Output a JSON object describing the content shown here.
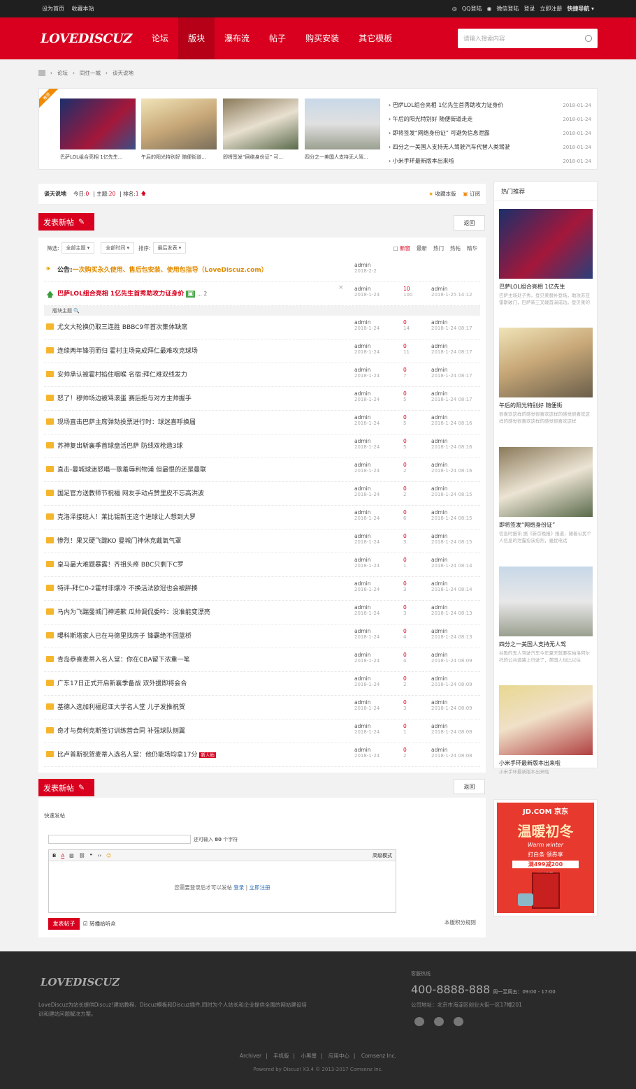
{
  "topbar": {
    "set_home": "设为首页",
    "bookmark": "收藏本站",
    "qq_login": "QQ登陆",
    "wechat_login": "微信登陆",
    "login": "登录",
    "register": "立即注册",
    "quick_nav": "快捷导航"
  },
  "header": {
    "logo": "LOVEDISCUZ",
    "nav": [
      "论坛",
      "版块",
      "瀑布流",
      "帖子",
      "购买安装",
      "其它模板"
    ],
    "search_placeholder": "请输入搜索内容"
  },
  "breadcrumb": [
    "论坛",
    "同住一城",
    "谈天说地"
  ],
  "recommend": {
    "ribbon": "推荐",
    "thumbs": [
      "巴萨LOL组合亮相 1亿先生...",
      "午后的阳光特别好 随便街道...",
      "即将签发“网络身份证” 可...",
      "四分之一美国人支持无人驾..."
    ],
    "list": [
      {
        "title": "巴萨LOL组合亮相 1亿先生首秀助攻力证身价",
        "date": "2018-01-24"
      },
      {
        "title": "午后的阳光特别好 随便街道走走",
        "date": "2018-01-24"
      },
      {
        "title": "即将签发“网络身份证” 可避免信息泄露",
        "date": "2018-01-24"
      },
      {
        "title": "四分之一美国人支持无人驾驶汽车代替人类驾驶",
        "date": "2018-01-24"
      },
      {
        "title": "小米手环最新版本出来啦",
        "date": "2018-01-24"
      }
    ]
  },
  "forum": {
    "name": "谈天说地",
    "today_label": "今日:",
    "today": "0",
    "topics_label": "主题:",
    "topics": "20",
    "rank_label": "排名:",
    "rank": "1",
    "fav": "收藏本版",
    "subscribe": "订阅"
  },
  "actions": {
    "new_post": "发表新帖",
    "back": "返回"
  },
  "filter": {
    "label": "筛选:",
    "type": "全部主题",
    "time": "全部时间",
    "sort_label": "排序:",
    "sort": "最后发表",
    "new_window": "新窗",
    "latest": "最新",
    "hot": "热门",
    "hot_posts": "热帖",
    "digest": "精华"
  },
  "announce": {
    "label": "公告:",
    "text": "一次购买永久使用、售后包安装、使用包指导（LoveDiscuz.com）",
    "author": "admin",
    "date": "2018-2-2"
  },
  "sticky": {
    "title": "巴萨LOL组合亮相 1亿先生首秀助攻力证身价",
    "pages": "... 2",
    "author": "admin",
    "date": "2018-1-24",
    "replies": "10",
    "views": "100",
    "last_user": "admin",
    "last_time": "2018-1-25 14:12"
  },
  "subhead": "版块主题",
  "threads": [
    {
      "title": "尤文大轮换仍取三连胜 BBBC9年首次集体缺席",
      "date": "2018-1-24",
      "replies": "0",
      "views": "14",
      "last": "2018-1-24 08:17"
    },
    {
      "title": "连续两年锋羽而归 霍村主场竟成拜仁最难攻克球场",
      "date": "2018-1-24",
      "replies": "0",
      "views": "11",
      "last": "2018-1-24 08:17"
    },
    {
      "title": "安帅承认被霍村掐住咽喉 名宿:拜仁难双线发力",
      "date": "2018-1-24",
      "replies": "0",
      "views": "7",
      "last": "2018-1-24 08:17"
    },
    {
      "title": "怒了！穆帅场边被骂滚蛋 赛后拒与对方主帅握手",
      "date": "2018-1-24",
      "replies": "0",
      "views": "5",
      "last": "2018-1-24 08:17"
    },
    {
      "title": "现场直击巴萨主席弹劾投票进行时：球迷喜呼换届",
      "date": "2018-1-24",
      "replies": "0",
      "views": "5",
      "last": "2018-1-24 08:16"
    },
    {
      "title": "苏神复出斩襄季首球盘活巴萨 防线双枪造3球",
      "date": "2018-1-24",
      "replies": "0",
      "views": "5",
      "last": "2018-1-24 08:16"
    },
    {
      "title": "直击-曼城球迷怒唱一歌羞辱利物浦 但最恨的还是曼联",
      "date": "2018-1-24",
      "replies": "0",
      "views": "2",
      "last": "2018-1-24 08:16"
    },
    {
      "title": "国足官方送教师节祝福 网友手动点赞里皮不忘高洪波",
      "date": "2018-1-24",
      "replies": "0",
      "views": "2",
      "last": "2018-1-24 08:15"
    },
    {
      "title": "克洛泽接班人！莱比锡新王这个进球让人想到大罗",
      "date": "2018-1-24",
      "replies": "0",
      "views": "6",
      "last": "2018-1-24 08:15"
    },
    {
      "title": "惨烈！果又硬飞踹KO 曼城门神休克戴氧气罩",
      "date": "2018-1-24",
      "replies": "0",
      "views": "3",
      "last": "2018-1-24 08:15"
    },
    {
      "title": "皇马最大难题暴露！齐祖头疼 BBC只剩下C罗",
      "date": "2018-1-24",
      "replies": "0",
      "views": "1",
      "last": "2018-1-24 08:14"
    },
    {
      "title": "特评-拜仁0-2霍村非爆冷 不换活法欧冠也会被胖揍",
      "date": "2018-1-24",
      "replies": "0",
      "views": "3",
      "last": "2018-1-24 08:14"
    },
    {
      "title": "马内为飞踹曼城门神道歉 瓜帅调侃委吟：没准能变漂亮",
      "date": "2018-1-24",
      "replies": "0",
      "views": "3",
      "last": "2018-1-24 08:13"
    },
    {
      "title": "曝科斯塔家人已在马德里找房子 锋霸绝不回蓝桥",
      "date": "2018-1-24",
      "replies": "0",
      "views": "4",
      "last": "2018-1-24 08:13"
    },
    {
      "title": "青岛恭喜麦蒂入名人堂：你在CBA留下浓重一笔",
      "date": "2018-1-24",
      "replies": "0",
      "views": "4",
      "last": "2018-1-24 08:09"
    },
    {
      "title": "广东17日正式开启新襄季备战 双外援即将会合",
      "date": "2018-1-24",
      "replies": "0",
      "views": "2",
      "last": "2018-1-24 08:09"
    },
    {
      "title": "基德入选加利福尼亚大学名人堂 儿子发推祝贺",
      "date": "2018-1-24",
      "replies": "0",
      "views": "3",
      "last": "2018-1-24 08:09"
    },
    {
      "title": "奇才与费利克斯签订训练营合同 补强球队侧翼",
      "date": "2018-1-24",
      "replies": "0",
      "views": "1",
      "last": "2018-1-24 08:08"
    },
    {
      "title": "比卢普斯祝贺麦蒂入选名人堂：他仍能场均拿17分",
      "date": "2018-1-24",
      "replies": "0",
      "views": "2",
      "last": "2018-1-24 08:08",
      "badge": "新人帖"
    }
  ],
  "thread_author": "admin",
  "hot": {
    "title": "热门推荐",
    "items": [
      {
        "title": "巴萨LOL组合亮相 1亿先生",
        "desc": "巴萨主场处子秀，登贝莱替补登场，助攻苏亚雷斯破门，巴萨新三叉戟首演成功。登贝莱的"
      },
      {
        "title": "午后的阳光特别好 随便街",
        "desc": "很喜欢这样的感觉很喜欢这样的感觉很喜欢这样的感觉很喜欢这样的感觉很喜欢这样"
      },
      {
        "title": "即将签发“网络身份证”",
        "desc": "信息时报讯 据《新京晚报》报道，随着公民个人信息的泄露愈演愈烈，骚扰电话"
      },
      {
        "title": "四分之一美国人支持无人驾",
        "desc": "谷歌的无人驾驶汽车今年夏天就要在帕洛阿尔托的公共道路上行驶了，美国人也比以往"
      },
      {
        "title": "小米手环最新版本出来啦",
        "desc": "小米手环最新版本出来啦"
      }
    ]
  },
  "ad": {
    "brand": "JD.COM 京东",
    "headline": "温暖初冬",
    "sub": "Warm winter",
    "offer1": "打白条 领券享",
    "offer2": "满499减200",
    "tag": "尚新季"
  },
  "quick": {
    "label": "快速发帖",
    "count_prefix": "还可输入",
    "count": "80",
    "count_suffix": "个字符",
    "advanced": "高级模式",
    "need_login": "您需要登录后才可以发帖",
    "login": "登录",
    "register": "立即注册",
    "post": "发表帖子",
    "share": "转播给听众",
    "rules": "本版积分规则"
  },
  "footer": {
    "logo": "LOVEDISCUZ",
    "desc": "LoveDiscuz为站长提供Discuz!建站教程、Discuz模板和Discuz插件,同时为个人站长和企业提供全面的网站建设培训和建站问题解决方案。",
    "hotline_label": "客服热线",
    "phone": "400-8888-888",
    "hours": "周一至周五：09:00 - 17:00",
    "address": "公司地址：北京市海淀区创业大街一区17幢201",
    "links": [
      "Archiver",
      "手机版",
      "小黑屋",
      "应用中心",
      "Comsenz Inc."
    ],
    "copyright": "Powered by Discuz! X3.4   © 2013-2017 Comsenz Inc."
  }
}
